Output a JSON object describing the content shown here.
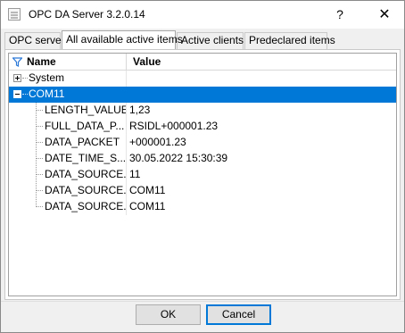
{
  "window": {
    "title": "OPC DA Server 3.2.0.14",
    "help_glyph": "?",
    "close_glyph": "✕"
  },
  "tabs": [
    {
      "label": "OPC server",
      "active": false
    },
    {
      "label": "All available active items",
      "active": true
    },
    {
      "label": "Active clients",
      "active": false
    },
    {
      "label": "Predeclared items",
      "active": false
    }
  ],
  "grid": {
    "columns": {
      "name": "Name",
      "value": "Value"
    },
    "rows": [
      {
        "name": "System",
        "value": "",
        "expander": "plus",
        "level": 0,
        "selected": false
      },
      {
        "name": "COM11",
        "value": "",
        "expander": "minus",
        "level": 0,
        "selected": true
      },
      {
        "name": "LENGTH_VALUE",
        "value": "1,23",
        "level": 1,
        "selected": false
      },
      {
        "name": "FULL_DATA_P...",
        "value": "RSIDL+000001.23",
        "level": 1,
        "selected": false
      },
      {
        "name": "DATA_PACKET",
        "value": "+000001.23",
        "level": 1,
        "selected": false
      },
      {
        "name": "DATE_TIME_S...",
        "value": "30.05.2022 15:30:39",
        "level": 1,
        "selected": false
      },
      {
        "name": "DATA_SOURCE...",
        "value": "11",
        "level": 1,
        "selected": false
      },
      {
        "name": "DATA_SOURCE...",
        "value": "COM11",
        "level": 1,
        "selected": false
      },
      {
        "name": "DATA_SOURCE...",
        "value": "COM11",
        "level": 1,
        "selected": false
      }
    ]
  },
  "buttons": {
    "ok": "OK",
    "cancel": "Cancel"
  },
  "colors": {
    "selection": "#0078d7",
    "focus_border": "#0078d7",
    "filter_icon": "#2b78d8"
  }
}
